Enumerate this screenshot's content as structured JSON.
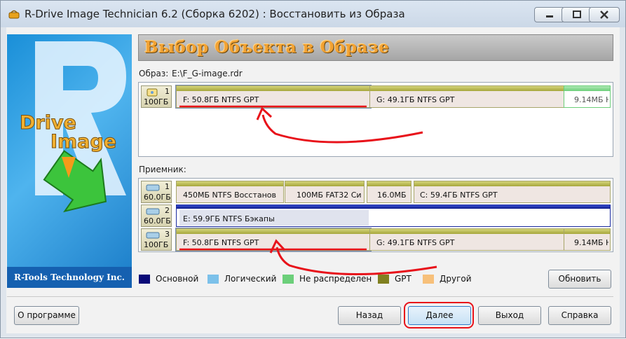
{
  "window": {
    "title": "R-Drive Image Technician 6.2 (Сборка 6202) : Восстановить из Образа"
  },
  "banner": {
    "logo_line1": "Drive",
    "logo_line2": "Image",
    "footer": "R-Tools Technology Inc."
  },
  "header": {
    "title": "Выбор Объекта в Образе"
  },
  "image_section": {
    "label": "Образ:",
    "path": "E:\\F_G-image.rdr",
    "disks": [
      {
        "number": "1",
        "size": "100ГБ",
        "partitions": [
          {
            "text": "F:  50.8ГБ  NTFS  GPT"
          },
          {
            "text": "G:  49.1ГБ  NTFS  GPT"
          },
          {
            "text": "9.14МБ  Н"
          }
        ]
      }
    ]
  },
  "target_section": {
    "label": "Приемник:",
    "disks": [
      {
        "number": "1",
        "size": "60.0ГБ",
        "partitions": [
          {
            "text": "450МБ  NTFS  Восстанов"
          },
          {
            "text": "100МБ  FAT32  Си"
          },
          {
            "text": "16.0МБ"
          },
          {
            "text": "C:  59.4ГБ  NTFS  GPT"
          }
        ]
      },
      {
        "number": "2",
        "size": "60.0ГБ",
        "partitions": [
          {
            "text": "E:  59.9ГБ  NTFS  Бэкапы"
          }
        ]
      },
      {
        "number": "3",
        "size": "100ГБ",
        "partitions": [
          {
            "text": "F:  50.8ГБ  NTFS  GPT"
          },
          {
            "text": "G:  49.1ГБ  NTFS  GPT"
          },
          {
            "text": "9.14МБ  Н"
          }
        ]
      }
    ]
  },
  "legend": [
    {
      "label": "Основной",
      "color": "#0a0a78"
    },
    {
      "label": "Логический",
      "color": "#7cc1ea"
    },
    {
      "label": "Не распределен",
      "color": "#6ccf7a"
    },
    {
      "label": "GPT",
      "color": "#808020"
    },
    {
      "label": "Другой",
      "color": "#f7c07a"
    }
  ],
  "buttons": {
    "refresh": "Обновить",
    "about": "О программе",
    "back": "Назад",
    "next": "Далее",
    "exit": "Выход",
    "help": "Справка"
  },
  "colors": {
    "annotation_red": "#e8121a",
    "header_text": "#f2a233",
    "partition_bar": "#a6a63c"
  }
}
